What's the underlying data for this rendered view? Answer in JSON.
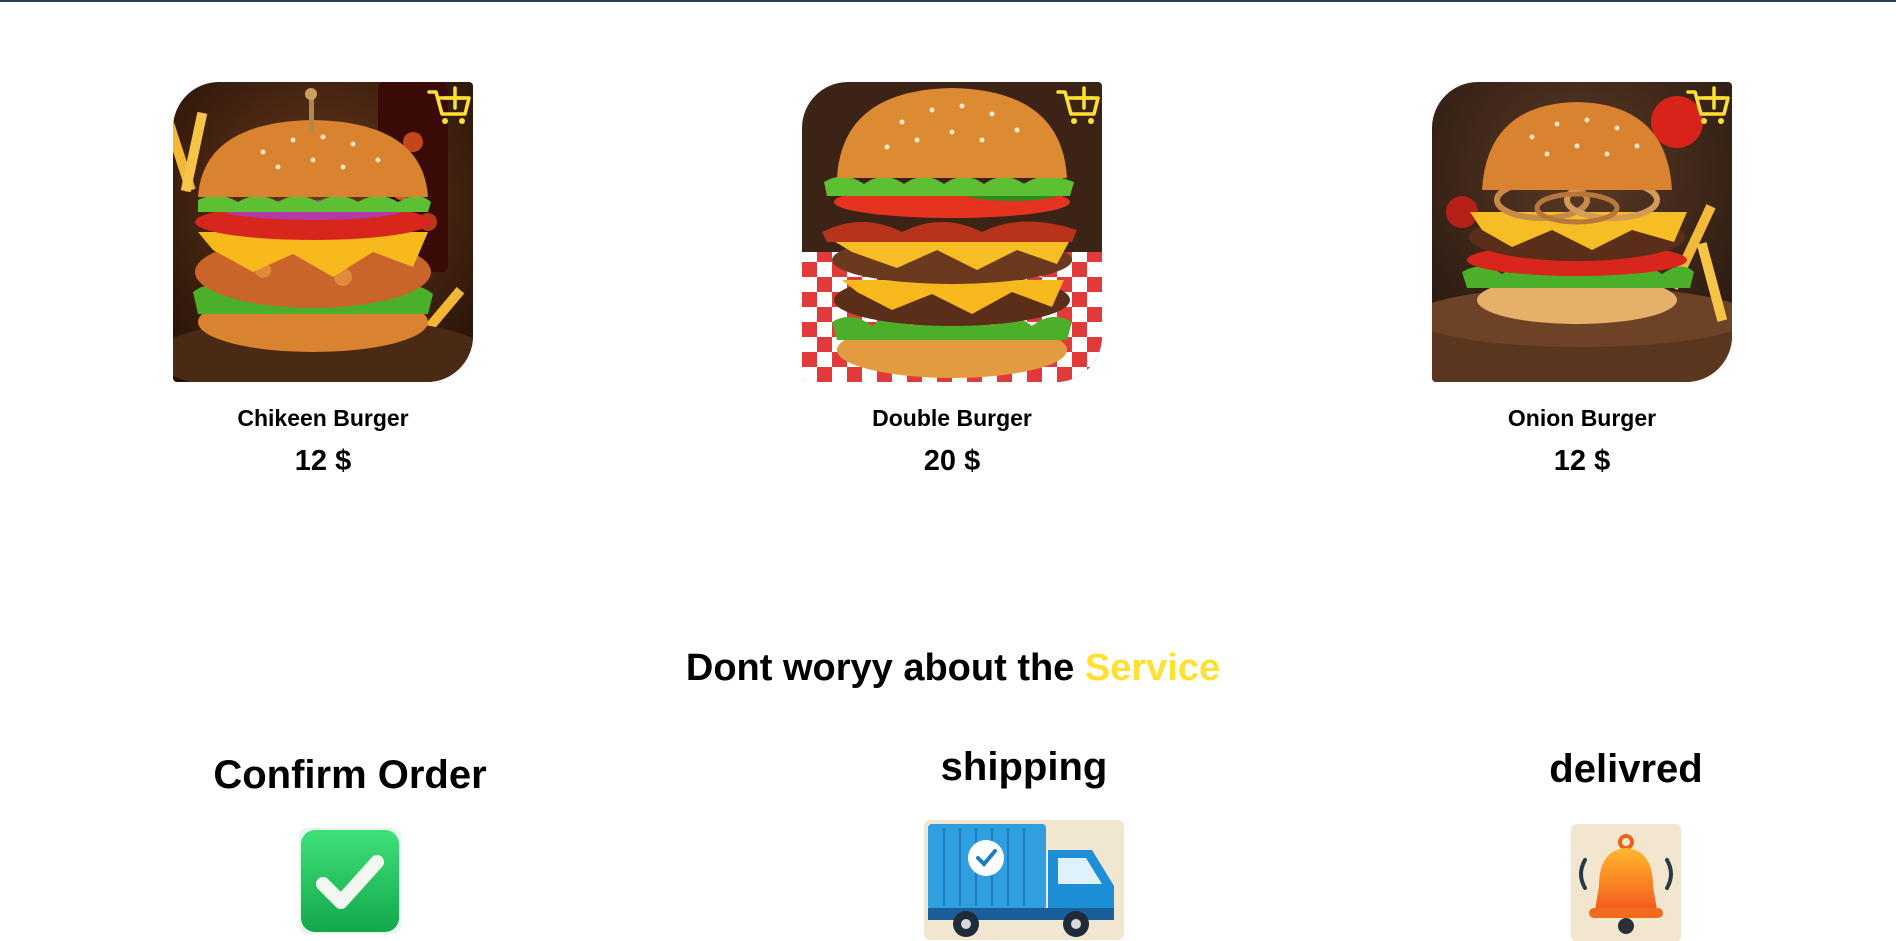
{
  "products": [
    {
      "name": "Chikeen Burger",
      "price": "12 $",
      "image": "chicken-burger-image",
      "cart_icon": "add-to-cart-icon"
    },
    {
      "name": "Double Burger",
      "price": "20 $",
      "image": "double-burger-image",
      "cart_icon": "add-to-cart-icon"
    },
    {
      "name": "Onion Burger",
      "price": "12 $",
      "image": "onion-burger-image",
      "cart_icon": "add-to-cart-icon"
    }
  ],
  "service": {
    "title_prefix": "Dont woryy about the",
    "title_accent": "Service",
    "steps": [
      {
        "title": "Confirm Order",
        "icon": "checkmark-icon"
      },
      {
        "title": "shipping",
        "icon": "delivery-truck-icon"
      },
      {
        "title": "delivred",
        "icon": "bell-icon"
      }
    ]
  },
  "colors": {
    "accent": "#ffe033",
    "text": "#000000",
    "topline": "#2a3b5c"
  }
}
